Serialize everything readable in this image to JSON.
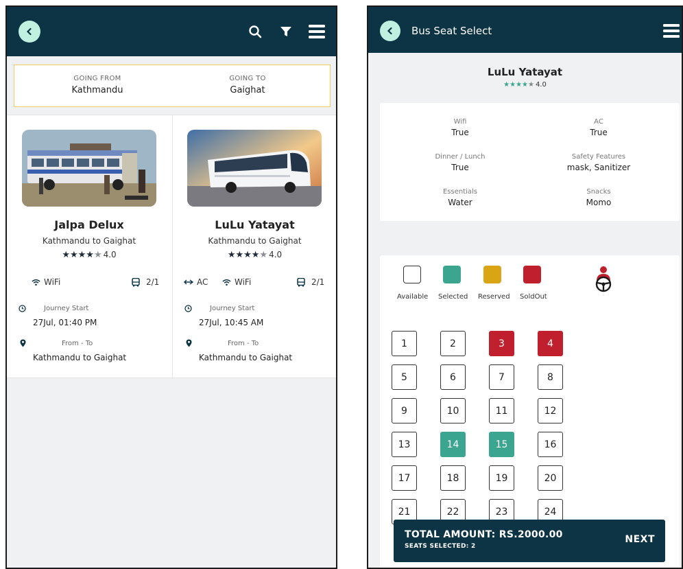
{
  "colors": {
    "header": "#0c3445",
    "accent": "#bff0e0",
    "selected": "#3ca58f",
    "reserved": "#d9a514",
    "soldout": "#c0202e",
    "route_border": "#f2cf63"
  },
  "list_screen": {
    "icons": {
      "back": "chevron-left-icon",
      "search": "search-icon",
      "filter": "filter-icon",
      "menu": "menu-icon"
    },
    "route": {
      "from_label": "GOING FROM",
      "from_value": "Kathmandu",
      "to_label": "GOING TO",
      "to_value": "Gaighat"
    },
    "buses": [
      {
        "name": "Jalpa Delux",
        "route": "Kathmandu to Gaighat",
        "rating": "4.0",
        "amenities": [
          {
            "icon": "wifi-icon",
            "label": "WiFi"
          }
        ],
        "seat_layout": "2/1",
        "journey_label": "Journey Start",
        "journey_value": "27Jul, 01:40 PM",
        "fromto_label": "From - To",
        "fromto_value": "Kathmandu to Gaighat"
      },
      {
        "name": "LuLu Yatayat",
        "route": "Kathmandu to Gaighat",
        "rating": "4.0",
        "amenities": [
          {
            "icon": "ac-icon",
            "label": "AC"
          },
          {
            "icon": "wifi-icon",
            "label": "WiFi"
          }
        ],
        "seat_layout": "2/1",
        "journey_label": "Journey Start",
        "journey_value": "27Jul, 10:45 AM",
        "fromto_label": "From - To",
        "fromto_value": "Kathmandu to Gaighat"
      }
    ]
  },
  "seat_screen": {
    "title": "Bus Seat Select",
    "operator": {
      "name": "LuLu Yatayat",
      "rating": "4.0"
    },
    "features": [
      {
        "label": "Wifi",
        "value": "True"
      },
      {
        "label": "AC",
        "value": "True"
      },
      {
        "label": "Dinner / Lunch",
        "value": "True"
      },
      {
        "label": "Safety Features",
        "value": "mask, Sanitizer"
      },
      {
        "label": "Essentials",
        "value": "Water"
      },
      {
        "label": "Snacks",
        "value": "Momo"
      }
    ],
    "legend": [
      {
        "label": "Available",
        "status": "available"
      },
      {
        "label": "Selected",
        "status": "selected"
      },
      {
        "label": "Reserved",
        "status": "reserved"
      },
      {
        "label": "SoldOut",
        "status": "soldout"
      }
    ],
    "seats": [
      {
        "n": "1",
        "status": "available"
      },
      {
        "n": "2",
        "status": "available"
      },
      {
        "n": "3",
        "status": "soldout"
      },
      {
        "n": "4",
        "status": "soldout"
      },
      {
        "n": "5",
        "status": "available"
      },
      {
        "n": "6",
        "status": "available"
      },
      {
        "n": "7",
        "status": "available"
      },
      {
        "n": "8",
        "status": "available"
      },
      {
        "n": "9",
        "status": "available"
      },
      {
        "n": "10",
        "status": "available"
      },
      {
        "n": "11",
        "status": "available"
      },
      {
        "n": "12",
        "status": "available"
      },
      {
        "n": "13",
        "status": "available"
      },
      {
        "n": "14",
        "status": "selected"
      },
      {
        "n": "15",
        "status": "selected"
      },
      {
        "n": "16",
        "status": "available"
      },
      {
        "n": "17",
        "status": "available"
      },
      {
        "n": "18",
        "status": "available"
      },
      {
        "n": "19",
        "status": "available"
      },
      {
        "n": "20",
        "status": "available"
      },
      {
        "n": "21",
        "status": "available"
      },
      {
        "n": "22",
        "status": "available"
      },
      {
        "n": "23",
        "status": "available"
      },
      {
        "n": "24",
        "status": "available"
      }
    ],
    "total": {
      "amount": "TOTAL AMOUNT: RS.2000.00",
      "seats": "SEATS SELECTED: 2",
      "next_label": "NEXT"
    }
  }
}
